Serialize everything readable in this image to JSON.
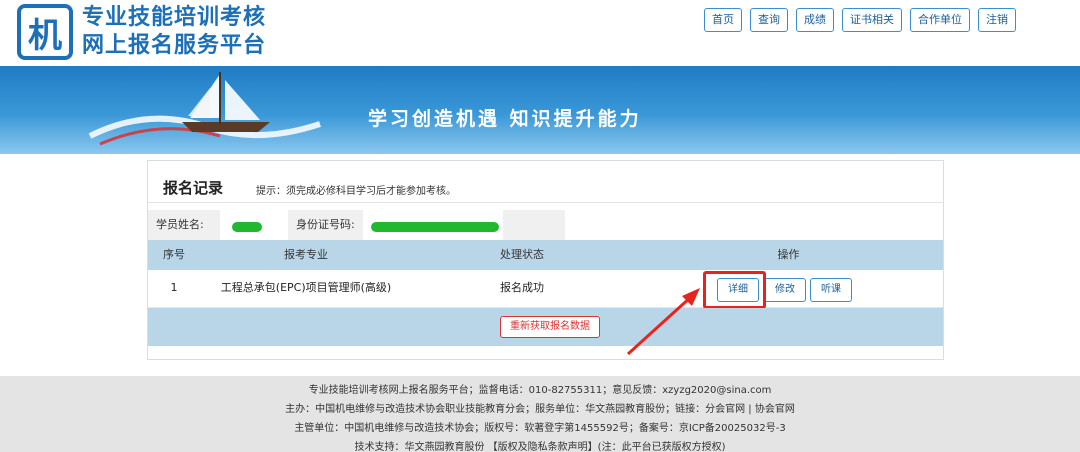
{
  "header": {
    "logo_char": "机",
    "title_line1": "专业技能培训考核",
    "title_line2": "网上报名服务平台",
    "brand_color": "#1d6fb8"
  },
  "nav": {
    "items": [
      {
        "label": "首页"
      },
      {
        "label": "查询"
      },
      {
        "label": "成绩"
      },
      {
        "label": "证书相关"
      },
      {
        "label": "合作单位"
      },
      {
        "label": "注销"
      }
    ]
  },
  "banner": {
    "slogan": "学习创造机遇  知识提升能力"
  },
  "record": {
    "title": "报名记录",
    "tip": "提示：须完成必修科目学习后才能参加考核。",
    "student_name_label": "学员姓名:",
    "id_number_label": "身份证号码:",
    "columns": {
      "seq": "序号",
      "major": "报考专业",
      "status": "处理状态",
      "actions": "操作"
    },
    "rows": [
      {
        "seq": "1",
        "major": "工程总承包(EPC)项目管理师(高级)",
        "status": "报名成功",
        "btn_detail": "详细",
        "btn_edit": "修改",
        "btn_listen": "听课"
      }
    ],
    "reload_label": "重新获取报名数据"
  },
  "footer": {
    "line1": "专业技能培训考核网上报名服务平台；监督电话：010-82755311；意见反馈：xzyzg2020@sina.com",
    "line2": "主办：中国机电维修与改造技术协会职业技能教育分会；服务单位：华文燕园教育股份；链接：分会官网 | 协会官网",
    "line3": "主管单位：中国机电维修与改造技术协会；版权号：软著登字第1455592号；备案号：京ICP备20025032号-3",
    "line4": "技术支持：华文燕园教育股份 【版权及隐私条款声明】(注：此平台已获版权方授权)"
  },
  "colors": {
    "accent": "#3a8fd0",
    "table_head": "#b9d6e8",
    "highlight": "#e8231b",
    "redaction": "#1fb82e"
  }
}
